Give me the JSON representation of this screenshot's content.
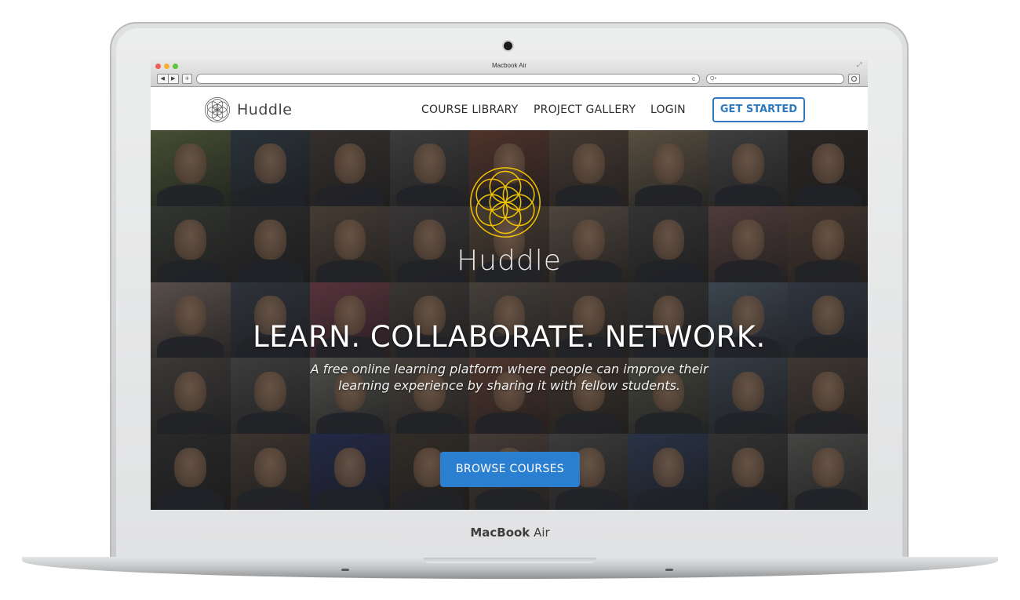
{
  "device": {
    "label_bold": "MacBook",
    "label_regular": " Air"
  },
  "browser": {
    "window_title": "Macbook Air",
    "back_glyph": "◀",
    "forward_glyph": "▶",
    "new_tab_glyph": "+",
    "search_placeholder": "Q•",
    "reload_glyph": "c"
  },
  "site": {
    "brand": "Huddle",
    "nav": {
      "course_library": "COURSE LIBRARY",
      "project_gallery": "PROJECT GALLERY",
      "login": "LOGIN",
      "get_started": "GET STARTED"
    },
    "hero": {
      "brand": "Huddle",
      "headline": "LEARN. COLLABORATE. NETWORK.",
      "subline": "A free online learning platform where people can improve their learning experience by sharing it with fellow students.",
      "cta": "BROWSE COURSES"
    }
  },
  "colors": {
    "accent_blue": "#2a7fd0",
    "outline_blue": "#2e79c0",
    "logo_gold": "#f2c300"
  },
  "icons": {
    "logo": "flower-of-life-icon",
    "reload": "reload-icon",
    "share": "share-icon"
  },
  "photo_tiles": [
    "#6b7a4a",
    "#3a4a55",
    "#4d4540",
    "#5a5a5a",
    "#7a4a3a",
    "#6a5646",
    "#8a7a60",
    "#5f5f5f",
    "#3e3632",
    "#4a4f46",
    "#3d3d3d",
    "#6a5a4a",
    "#545050",
    "#6d5a45",
    "#7a6a5a",
    "#4c4c4c",
    "#7a5a55",
    "#6a5042",
    "#8a7a70",
    "#434a55",
    "#8a4a5a",
    "#55504a",
    "#6a6055",
    "#5d5248",
    "#4a4a4a",
    "#5a6a7a",
    "#455060",
    "#5a5550",
    "#5b5b5b",
    "#7a7a72",
    "#6a5e52",
    "#7a5040",
    "#5a4a3a",
    "#6a6a5a",
    "#4d5a66",
    "#5e5248",
    "#3a3a3a",
    "#5a4d42",
    "#2e3a6a",
    "#4a4035",
    "#6a5a4e",
    "#5a5a5a",
    "#3a4a6a",
    "#4a4a4a",
    "#6a6a66"
  ]
}
